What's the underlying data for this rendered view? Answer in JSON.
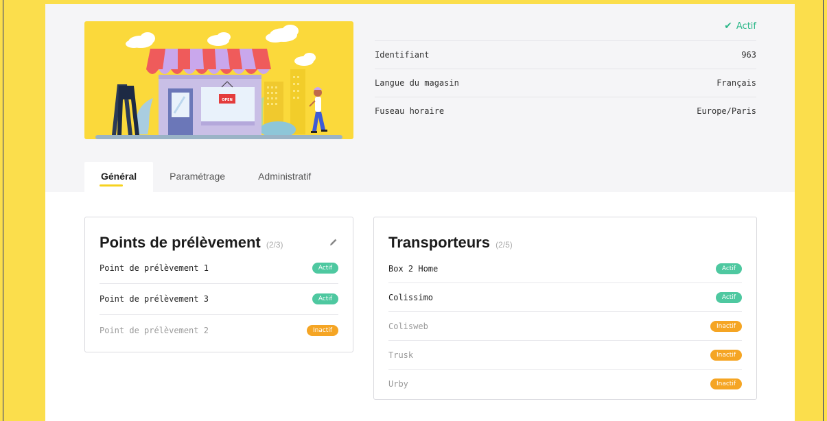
{
  "status": {
    "label": "Actif",
    "color": "#2eb88a"
  },
  "info": [
    {
      "label": "Identifiant",
      "value": "963"
    },
    {
      "label": "Langue du magasin",
      "value": "Français"
    },
    {
      "label": "Fuseau horaire",
      "value": "Europe/Paris"
    }
  ],
  "illustration": {
    "sign_text": "OPEN"
  },
  "tabs": [
    {
      "label": "Général",
      "active": true
    },
    {
      "label": "Paramétrage",
      "active": false
    },
    {
      "label": "Administratif",
      "active": false
    }
  ],
  "points": {
    "title": "Points de prélèvement",
    "count": "(2/3)",
    "items": [
      {
        "label": "Point de prélèvement 1",
        "status": "Actif"
      },
      {
        "label": "Point de prélèvement 3",
        "status": "Actif"
      },
      {
        "label": "Point de prélèvement 2",
        "status": "Inactif"
      }
    ]
  },
  "transporteurs": {
    "title": "Transporteurs",
    "count": "(2/5)",
    "items": [
      {
        "label": "Box 2 Home",
        "status": "Actif"
      },
      {
        "label": "Colissimo",
        "status": "Actif"
      },
      {
        "label": "Colisweb",
        "status": "Inactif"
      },
      {
        "label": "Trusk",
        "status": "Inactif"
      },
      {
        "label": "Urby",
        "status": "Inactif"
      }
    ]
  },
  "colors": {
    "accent_yellow": "#fbde4c",
    "actif": "#4ec8a0",
    "inactif": "#f5a524"
  }
}
